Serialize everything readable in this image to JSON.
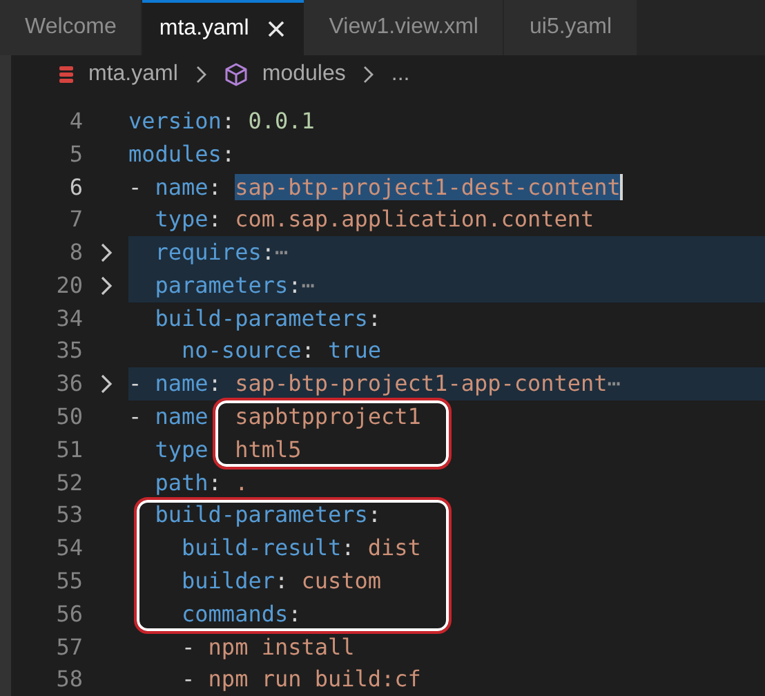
{
  "tabs": [
    {
      "label": "Welcome",
      "selected": false,
      "closable": false
    },
    {
      "label": "mta.yaml",
      "selected": true,
      "closable": true
    },
    {
      "label": "View1.view.xml",
      "selected": false,
      "closable": false
    },
    {
      "label": "ui5.yaml",
      "selected": false,
      "closable": false
    }
  ],
  "breadcrumb": [
    {
      "label": "mta.yaml",
      "kind": "file"
    },
    {
      "label": "modules",
      "kind": "module"
    },
    {
      "label": "...",
      "kind": "more"
    }
  ],
  "lines": [
    {
      "number": "4",
      "current": false,
      "folded": false,
      "tokens": [
        {
          "text": "version",
          "kind": "key"
        },
        {
          "text": ": ",
          "kind": "punct"
        },
        {
          "text": "0.0.1",
          "kind": "number"
        }
      ]
    },
    {
      "number": "5",
      "current": false,
      "folded": false,
      "tokens": [
        {
          "text": "modules",
          "kind": "key"
        },
        {
          "text": ":",
          "kind": "punct"
        }
      ]
    },
    {
      "number": "6",
      "current": true,
      "folded": false,
      "tokens": [
        {
          "text": "- ",
          "kind": "punct"
        },
        {
          "text": "name",
          "kind": "key"
        },
        {
          "text": ": ",
          "kind": "punct"
        },
        {
          "text": "sap-btp-project1-dest-content",
          "kind": "selection"
        }
      ]
    },
    {
      "number": "7",
      "current": false,
      "folded": false,
      "tokens": [
        {
          "text": "  type",
          "kind": "key"
        },
        {
          "text": ": ",
          "kind": "punct"
        },
        {
          "text": "com.sap.application.content",
          "kind": "value"
        }
      ]
    },
    {
      "number": "8",
      "current": false,
      "folded": true,
      "tokens": [
        {
          "text": "  requires",
          "kind": "key"
        },
        {
          "text": ":",
          "kind": "punct"
        },
        {
          "text": "⋯",
          "kind": "ellipsis"
        }
      ]
    },
    {
      "number": "20",
      "current": false,
      "folded": true,
      "tokens": [
        {
          "text": "  parameters",
          "kind": "key"
        },
        {
          "text": ":",
          "kind": "punct"
        },
        {
          "text": "⋯",
          "kind": "ellipsis"
        }
      ]
    },
    {
      "number": "34",
      "current": false,
      "folded": false,
      "tokens": [
        {
          "text": "  build-parameters",
          "kind": "key"
        },
        {
          "text": ":",
          "kind": "punct"
        }
      ]
    },
    {
      "number": "35",
      "current": false,
      "folded": false,
      "tokens": [
        {
          "text": "    no-source",
          "kind": "key"
        },
        {
          "text": ": ",
          "kind": "punct"
        },
        {
          "text": "true",
          "kind": "keyword"
        }
      ]
    },
    {
      "number": "36",
      "current": false,
      "folded": true,
      "tokens": [
        {
          "text": "- ",
          "kind": "punct"
        },
        {
          "text": "name",
          "kind": "key"
        },
        {
          "text": ": ",
          "kind": "punct"
        },
        {
          "text": "sap-btp-project1-app-content",
          "kind": "value"
        },
        {
          "text": "⋯",
          "kind": "ellipsis"
        }
      ]
    },
    {
      "number": "50",
      "current": false,
      "folded": false,
      "framed": true,
      "tokens": [
        {
          "text": "- ",
          "kind": "punct"
        },
        {
          "text": "name",
          "kind": "key"
        },
        {
          "kind": "gap"
        },
        {
          "text": "sapbtpproject1",
          "kind": "value"
        }
      ]
    },
    {
      "number": "51",
      "current": false,
      "folded": false,
      "framed": true,
      "tokens": [
        {
          "text": "  type",
          "kind": "key"
        },
        {
          "kind": "gap"
        },
        {
          "text": "html5",
          "kind": "value"
        }
      ]
    },
    {
      "number": "52",
      "current": false,
      "folded": false,
      "framed": false,
      "tokens": [
        {
          "text": "  path",
          "kind": "key"
        },
        {
          "text": ": ",
          "kind": "punct"
        },
        {
          "text": ".",
          "kind": "value"
        }
      ]
    },
    {
      "number": "53",
      "current": false,
      "folded": false,
      "framed": true,
      "tokens": [
        {
          "text": "  build-parameters",
          "kind": "key"
        },
        {
          "text": ":",
          "kind": "punct"
        }
      ]
    },
    {
      "number": "54",
      "current": false,
      "folded": false,
      "framed": true,
      "tokens": [
        {
          "text": "    build-result",
          "kind": "key"
        },
        {
          "text": ": ",
          "kind": "punct"
        },
        {
          "text": "dist",
          "kind": "value"
        }
      ]
    },
    {
      "number": "55",
      "current": false,
      "folded": false,
      "framed": true,
      "tokens": [
        {
          "text": "    builder",
          "kind": "key"
        },
        {
          "text": ": ",
          "kind": "punct"
        },
        {
          "text": "custom",
          "kind": "value"
        }
      ]
    },
    {
      "number": "56",
      "current": false,
      "folded": false,
      "framed": true,
      "tokens": [
        {
          "text": "    commands",
          "kind": "key"
        },
        {
          "text": ":",
          "kind": "punct"
        }
      ]
    },
    {
      "number": "57",
      "current": false,
      "folded": false,
      "tokens": [
        {
          "text": "    - ",
          "kind": "punct"
        },
        {
          "text": "npm install",
          "kind": "value"
        }
      ]
    },
    {
      "number": "58",
      "current": false,
      "folded": false,
      "tokens": [
        {
          "text": "    - ",
          "kind": "punct"
        },
        {
          "text": "npm run build:cf",
          "kind": "value"
        }
      ]
    }
  ]
}
